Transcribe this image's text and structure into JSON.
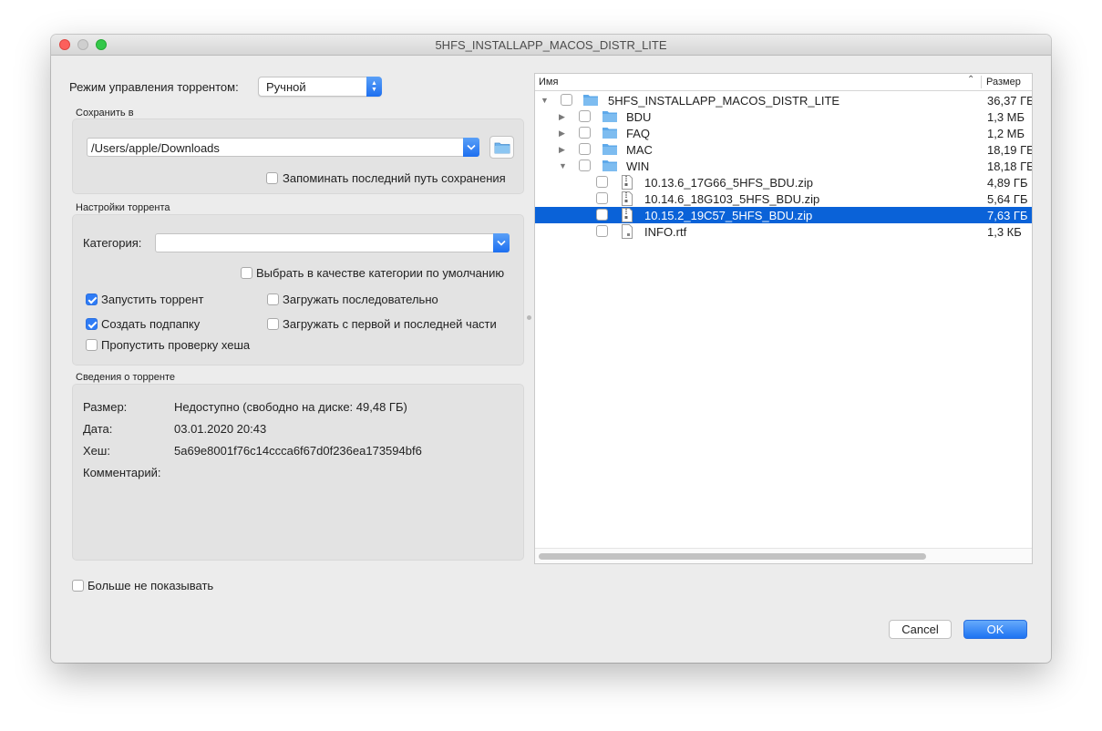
{
  "window": {
    "title": "5HFS_INSTALLAPP_MACOS_DISTR_LITE"
  },
  "mode": {
    "label": "Режим управления торрентом:",
    "value": "Ручной"
  },
  "save": {
    "group_title": "Сохранить в",
    "path": "/Users/apple/Downloads",
    "remember_label": "Запоминать последний путь сохранения",
    "remember_checked": false
  },
  "settings": {
    "group_title": "Настройки торрента",
    "category_label": "Категория:",
    "category_value": "",
    "default_category_label": "Выбрать в качестве категории по умолчанию",
    "start_torrent_label": "Запустить торрент",
    "sequential_label": "Загружать последовательно",
    "create_subfolder_label": "Создать подпапку",
    "first_last_label": "Загружать с первой и последней части",
    "skip_hash_label": "Пропустить проверку хеша"
  },
  "info": {
    "group_title": "Сведения о торренте",
    "size_label": "Размер:",
    "size_value": "Недоступно (свободно на диске: 49,48 ГБ)",
    "date_label": "Дата:",
    "date_value": "03.01.2020 20:43",
    "hash_label": "Хеш:",
    "hash_value": "5a69e8001f76c14ccca6f67d0f236ea173594bf6",
    "comment_label": "Комментарий:"
  },
  "tree": {
    "col_name": "Имя",
    "col_size": "Размер",
    "sort_indicator": "⌃",
    "rows": [
      {
        "name": "5HFS_INSTALLAPP_MACOS_DISTR_LITE",
        "size": "36,37 ГБ"
      },
      {
        "name": "BDU",
        "size": "1,3 МБ"
      },
      {
        "name": "FAQ",
        "size": "1,2 МБ"
      },
      {
        "name": "MAC",
        "size": "18,19 ГБ"
      },
      {
        "name": "WIN",
        "size": "18,18 ГБ"
      },
      {
        "name": "10.13.6_17G66_5HFS_BDU.zip",
        "size": "4,89 ГБ"
      },
      {
        "name": "10.14.6_18G103_5HFS_BDU.zip",
        "size": "5,64 ГБ"
      },
      {
        "name": "10.15.2_19C57_5HFS_BDU.zip",
        "size": "7,63 ГБ"
      },
      {
        "name": "INFO.rtf",
        "size": "1,3 КБ"
      }
    ],
    "selected_row": "10.15.2_19C57_5HFS_BDU.zip",
    "expand_open": "▼",
    "expand_closed": "▶"
  },
  "footer": {
    "dont_show_label": "Больше не показывать",
    "cancel_label": "Cancel",
    "ok_label": "OK"
  },
  "colors": {
    "accent": "#1d73f2",
    "selection": "#0a62d8",
    "folder": "#6fb3ec"
  },
  "icons": [
    "folder-icon",
    "zip-file-icon",
    "rtf-file-icon",
    "chevron-down-icon",
    "folder-open-icon"
  ]
}
